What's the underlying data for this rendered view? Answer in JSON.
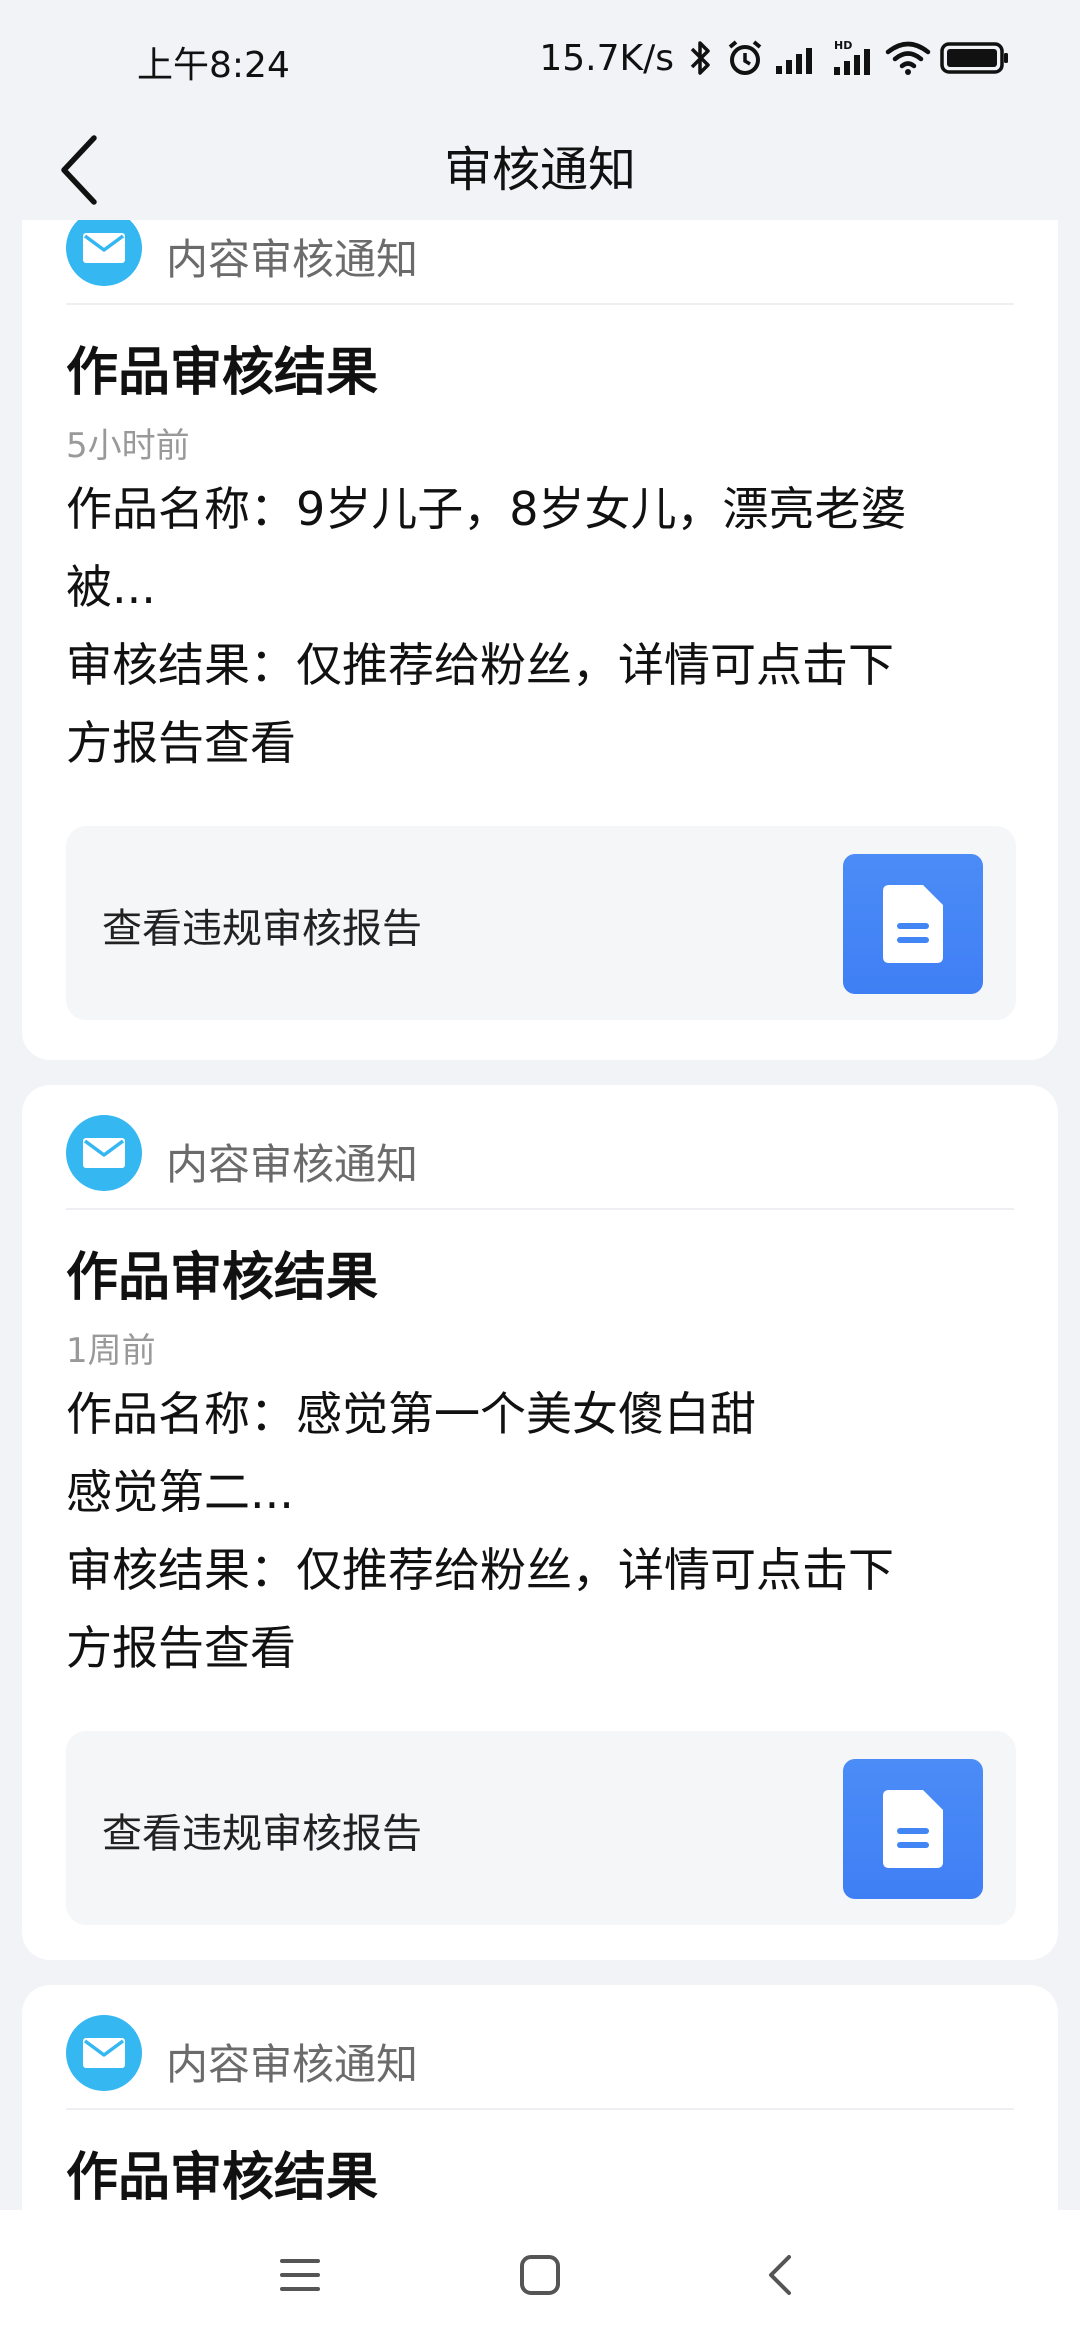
{
  "status_bar": {
    "time": "上午8:24",
    "net_speed": "15.7K/s",
    "signal_label": "HD"
  },
  "header": {
    "title": "审核通知"
  },
  "cards": [
    {
      "source": "内容审核通知",
      "title": "作品审核结果",
      "time": "5小时前",
      "work_name_line1": "作品名称：9岁儿子，8岁女儿，漂亮老婆",
      "work_name_line2": "被...",
      "result_line1": "审核结果：仅推荐给粉丝，详情可点击下",
      "result_line2": "方报告查看",
      "report_label": "查看违规审核报告"
    },
    {
      "source": "内容审核通知",
      "title": "作品审核结果",
      "time": "1周前",
      "work_name_line1": "作品名称：感觉第一个美女傻白甜",
      "work_name_line2": "感觉第二...",
      "result_line1": "审核结果：仅推荐给粉丝，详情可点击下",
      "result_line2": "方报告查看",
      "report_label": "查看违规审核报告"
    },
    {
      "source": "内容审核通知",
      "title": "作品审核结果"
    }
  ],
  "colors": {
    "accent_blue": "#4285f4",
    "mail_icon_blue": "#35b7f2",
    "background": "#f2f3f7"
  },
  "icons": {
    "back": "chevron-left-icon",
    "mail": "envelope-icon",
    "report": "document-icon",
    "nav_menu": "menu-icon",
    "nav_home": "square-icon",
    "nav_back": "chevron-left-icon"
  }
}
